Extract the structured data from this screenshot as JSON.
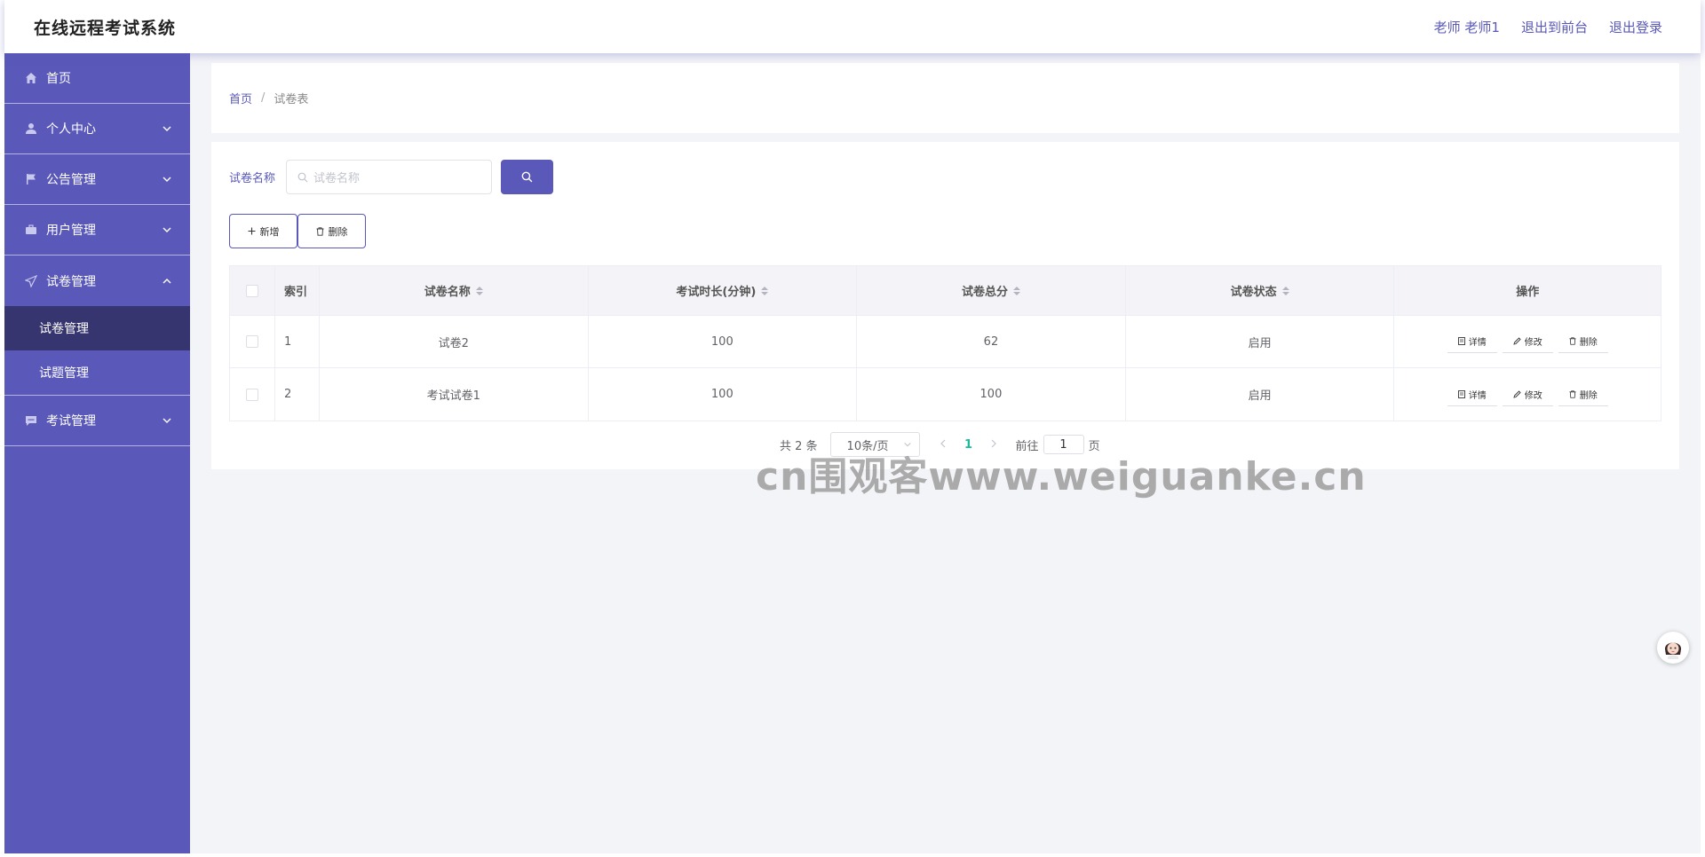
{
  "header": {
    "app_title": "在线远程考试系统",
    "user_label": "老师 老师1",
    "front_link": "退出到前台",
    "logout_link": "退出登录"
  },
  "sidebar": {
    "items": [
      {
        "label": "首页",
        "icon": "home-icon"
      },
      {
        "label": "个人中心",
        "icon": "user-icon"
      },
      {
        "label": "公告管理",
        "icon": "flag-icon"
      },
      {
        "label": "用户管理",
        "icon": "briefcase-icon"
      },
      {
        "label": "试卷管理",
        "icon": "send-icon",
        "expanded": true,
        "children": [
          {
            "label": "试卷管理",
            "active": true
          },
          {
            "label": "试题管理",
            "active": false
          }
        ]
      },
      {
        "label": "考试管理",
        "icon": "chat-icon"
      }
    ]
  },
  "breadcrumb": {
    "home": "首页",
    "separator": "/",
    "current": "试卷表"
  },
  "search": {
    "label": "试卷名称",
    "placeholder": "试卷名称"
  },
  "actions": {
    "add_label": "新增",
    "delete_label": "删除"
  },
  "table": {
    "headers": {
      "index": "索引",
      "name": "试卷名称",
      "duration": "考试时长(分钟)",
      "score": "试卷总分",
      "status": "试卷状态",
      "ops": "操作"
    },
    "rows": [
      {
        "index": "1",
        "name": "试卷2",
        "duration": "100",
        "score": "62",
        "status": "启用"
      },
      {
        "index": "2",
        "name": "考试试卷1",
        "duration": "100",
        "score": "100",
        "status": "启用"
      }
    ],
    "op_labels": {
      "detail": "详情",
      "edit": "修改",
      "delete": "删除"
    }
  },
  "pagination": {
    "total_text": "共 2 条",
    "page_size": "10条/页",
    "current_page": "1",
    "goto_label": "前往",
    "goto_value": "1",
    "page_suffix": "页"
  },
  "watermark": "cn围观客www.weiguanke.cn",
  "colors": {
    "primary": "#5a58b8",
    "sidebar_active": "#36356f",
    "page_bg": "#f3f4f7",
    "pager_active": "#1abc9c"
  }
}
